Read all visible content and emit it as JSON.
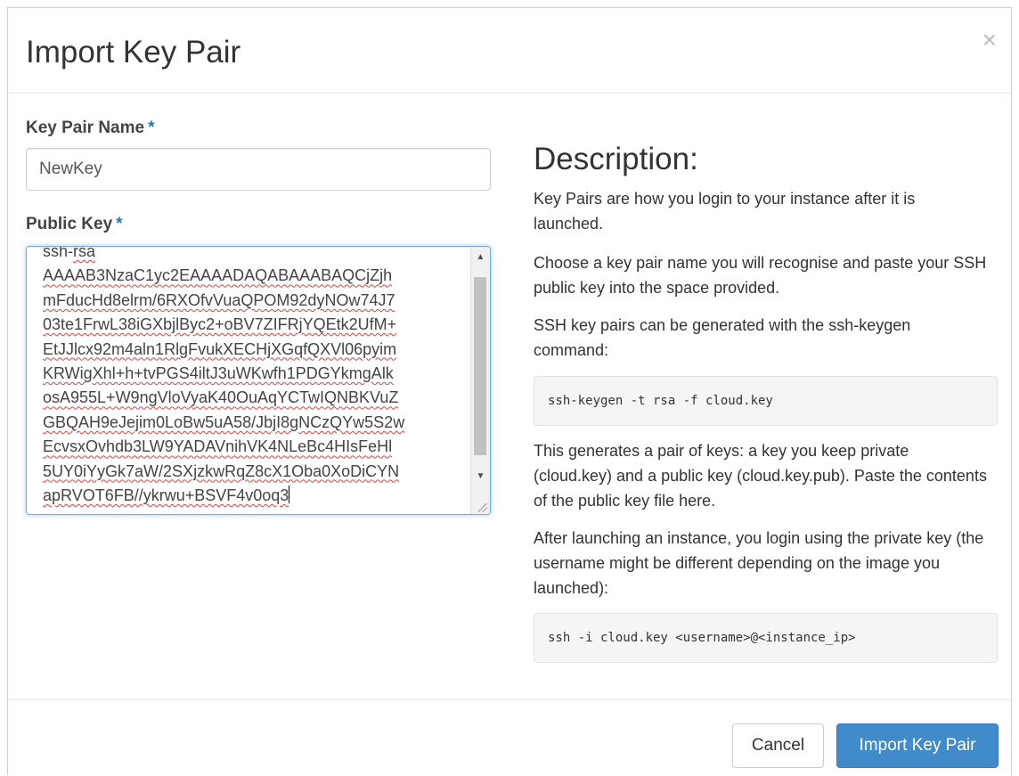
{
  "dialog": {
    "title": "Import Key Pair",
    "close_label": "×"
  },
  "form": {
    "key_pair_name_label": "Key Pair Name",
    "key_pair_name_value": "NewKey",
    "public_key_label": "Public Key",
    "required_mark": "*",
    "public_key_lines": [
      "ssh-rsa",
      "AAAAB3NzaC1yc2EAAAADAQABAAABAQCjZjh",
      "mFducHd8elrm/6RXOfvVuaQPOM92dyNOw74J7",
      "03te1FrwL38iGXbjlByc2+oBV7ZIFRjYQEtk2UfM+",
      "EtJJlcx92m4aln1RlgFvukXECHjXGqfQXVl06pyim",
      "KRWigXhl+h+tvPGS4iltJ3uWKwfh1PDGYkmgAlk",
      "osA955L+W9ngVloVyaK40OuAqYCTwIQNBKVuZ",
      "GBQAH9eJejim0LoBw5uA58/JbjI8gNCzQYw5S2w",
      "EcvsxOvhdb3LW9YADAVnihVK4NLeBc4HIsFeHl",
      "5UY0iYyGk7aW/2SXjzkwRqZ8cX1Oba0XoDiCYN",
      "apRVOT6FB//ykrwu+BSVF4v0oq3"
    ]
  },
  "description": {
    "title": "Description:",
    "p1": "Key Pairs are how you login to your instance after it is launched.",
    "p2": "Choose a key pair name you will recognise and paste your SSH public key into the space provided.",
    "p3": "SSH key pairs can be generated with the ssh-keygen command:",
    "code1": "ssh-keygen -t rsa -f cloud.key",
    "p4": "This generates a pair of keys: a key you keep private (cloud.key) and a public key (cloud.key.pub). Paste the contents of the public key file here.",
    "p5": "After launching an instance, you login using the private key (the username might be different depending on the image you launched):",
    "code2": "ssh -i cloud.key <username>@<instance_ip>"
  },
  "footer": {
    "cancel_label": "Cancel",
    "submit_label": "Import Key Pair"
  },
  "colors": {
    "primary": "#428bca",
    "required": "#3276b1",
    "focus_border": "#66afe9"
  }
}
